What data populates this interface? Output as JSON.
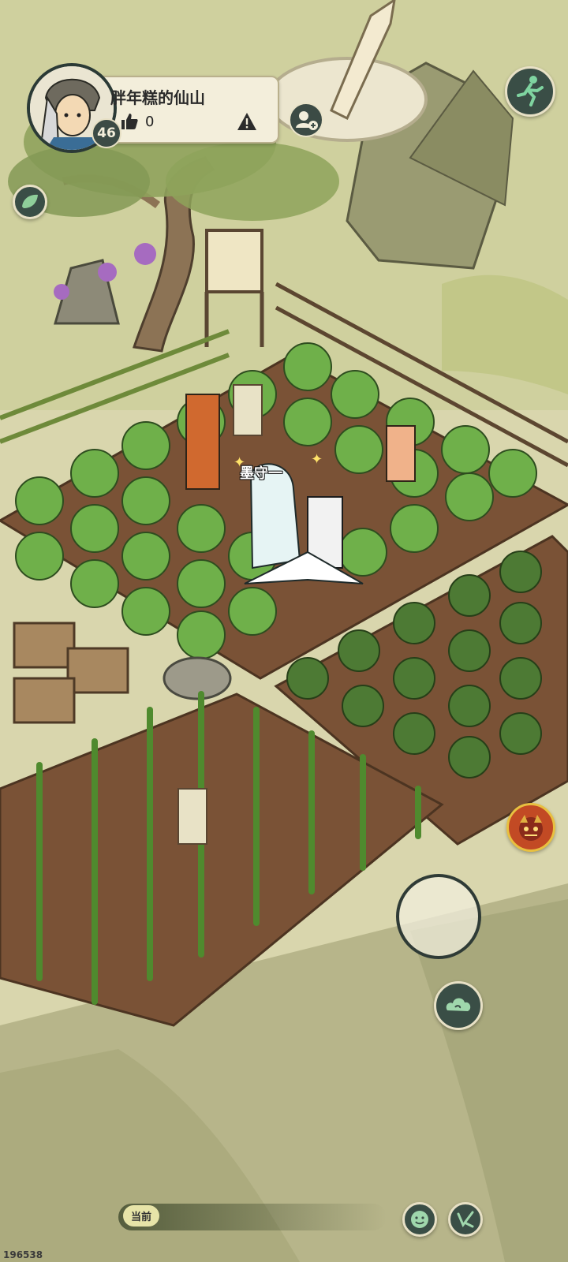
{
  "profile": {
    "name": "胖年糕的仙山",
    "level": "46",
    "likes": "0"
  },
  "player": {
    "name": "墨守一"
  },
  "chat": {
    "channel_label": "当前"
  },
  "footer": {
    "build_id": "196538"
  },
  "icons": {
    "like": "thumbs-up-icon",
    "report": "warning-icon",
    "visit": "add-friend-icon",
    "run": "running-person-icon",
    "side": "leaf-icon",
    "monster": "monster-face-icon",
    "cloud": "cloud-swirl-icon",
    "emoji": "smiley-icon",
    "chat": "pen-message-icon"
  },
  "colors": {
    "button_dark": "#3a4e46",
    "card_bg": "#f3eedb",
    "monster_button": "#c24a24",
    "ground": "#dcd9b2",
    "soil": "#7a5236"
  }
}
